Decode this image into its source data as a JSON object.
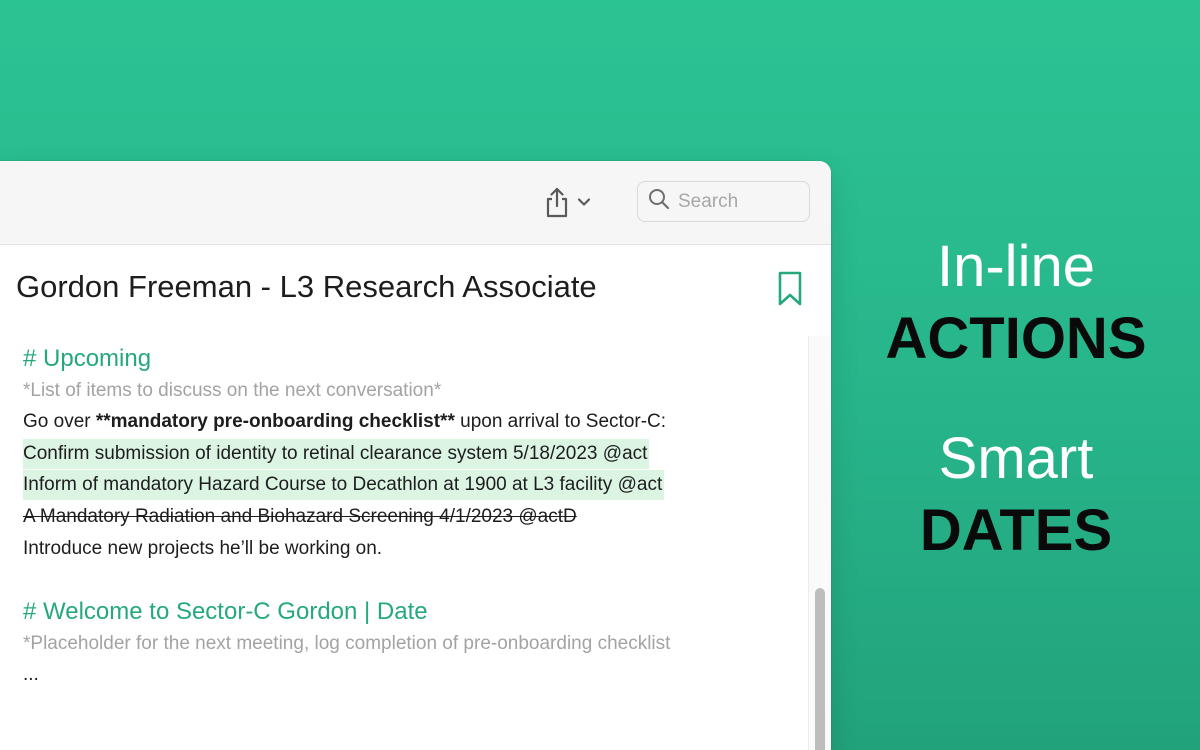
{
  "toolbar": {
    "share_icon": "share-icon",
    "chevron_icon": "chevron-down-icon",
    "search_icon": "search-icon",
    "search_placeholder": "Search"
  },
  "note": {
    "title": "Gordon Freeman - L3 Research Associate",
    "bookmark_icon": "bookmark-icon",
    "accent_color": "#25a97c",
    "lines": {
      "h1": "# Upcoming",
      "h1_sub": "*List of items to discuss on the next conversation*",
      "line1_a": "Go over ",
      "line1_b": "**mandatory pre-onboarding checklist**",
      "line1_c": " upon arrival to Sector-C:",
      "action1": "Confirm submission of identity to retinal clearance system  5/18/2023 @act",
      "action2": "Inform of mandatory Hazard Course to Decathlon at 1900 at L3 facility  @act",
      "action3_done": "A Mandatory Radiation and Biohazard Screening 4/1/2023 @actD",
      "line5": "Introduce new projects he’ll be working on.",
      "h2": "# Welcome to Sector-C Gordon | Date",
      "h2_sub": "*Placeholder for the next meeting, log completion of pre-onboarding checklist",
      "ellipsis": "..."
    }
  },
  "promo": {
    "line1": "In-line",
    "line2": "ACTIONS",
    "line3": "Smart",
    "line4": "DATES"
  }
}
